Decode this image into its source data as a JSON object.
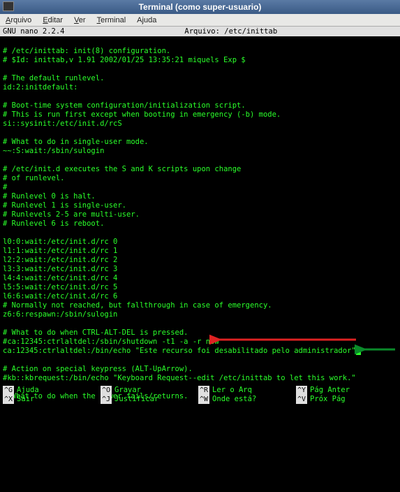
{
  "window": {
    "title": "Terminal (como super-usuario)"
  },
  "menubar": {
    "items": [
      {
        "label": "Arquivo",
        "accel": "A"
      },
      {
        "label": "Editar",
        "accel": "E"
      },
      {
        "label": "Ver",
        "accel": "V"
      },
      {
        "label": "Terminal",
        "accel": "T"
      },
      {
        "label": "Ajuda",
        "accel": "j"
      }
    ]
  },
  "editor": {
    "app": "GNU nano 2.2.4",
    "file_prefix": "Arquivo:",
    "file_path": "/etc/inittab",
    "lines": [
      "",
      "# /etc/inittab: init(8) configuration.",
      "# $Id: inittab,v 1.91 2002/01/25 13:35:21 miquels Exp $",
      "",
      "# The default runlevel.",
      "id:2:initdefault:",
      "",
      "# Boot-time system configuration/initialization script.",
      "# This is run first except when booting in emergency (-b) mode.",
      "si::sysinit:/etc/init.d/rcS",
      "",
      "# What to do in single-user mode.",
      "~~:S:wait:/sbin/sulogin",
      "",
      "# /etc/init.d executes the S and K scripts upon change",
      "# of runlevel.",
      "#",
      "# Runlevel 0 is halt.",
      "# Runlevel 1 is single-user.",
      "# Runlevels 2-5 are multi-user.",
      "# Runlevel 6 is reboot.",
      "",
      "l0:0:wait:/etc/init.d/rc 0",
      "l1:1:wait:/etc/init.d/rc 1",
      "l2:2:wait:/etc/init.d/rc 2",
      "l3:3:wait:/etc/init.d/rc 3",
      "l4:4:wait:/etc/init.d/rc 4",
      "l5:5:wait:/etc/init.d/rc 5",
      "l6:6:wait:/etc/init.d/rc 6",
      "# Normally not reached, but fallthrough in case of emergency.",
      "z6:6:respawn:/sbin/sulogin",
      "",
      "# What to do when CTRL-ALT-DEL is pressed.",
      "#ca:12345:ctrlaltdel:/sbin/shutdown -t1 -a -r now",
      "ca:12345:ctrlaltdel:/bin/echo \"Este recurso foi desabilitado pelo administrador\"",
      "",
      "# Action on special keypress (ALT-UpArrow).",
      "#kb::kbrequest:/bin/echo \"Keyboard Request--edit /etc/inittab to let this work.\"",
      "",
      "# What to do when the power fails/returns."
    ],
    "cursor_line_index": 34
  },
  "footer": {
    "rows": [
      [
        {
          "key": "^G",
          "label": "Ajuda"
        },
        {
          "key": "^O",
          "label": "Gravar"
        },
        {
          "key": "^R",
          "label": "Ler o Arq"
        },
        {
          "key": "^Y",
          "label": "Pág Anter"
        }
      ],
      [
        {
          "key": "^X",
          "label": "Sair"
        },
        {
          "key": "^J",
          "label": "Justificar"
        },
        {
          "key": "^W",
          "label": "Onde está?"
        },
        {
          "key": "^V",
          "label": "Próx Pág"
        }
      ]
    ]
  },
  "annotations": {
    "red_arrow_target": "commented shutdown line",
    "green_arrow_target": "new echo line cursor position"
  }
}
